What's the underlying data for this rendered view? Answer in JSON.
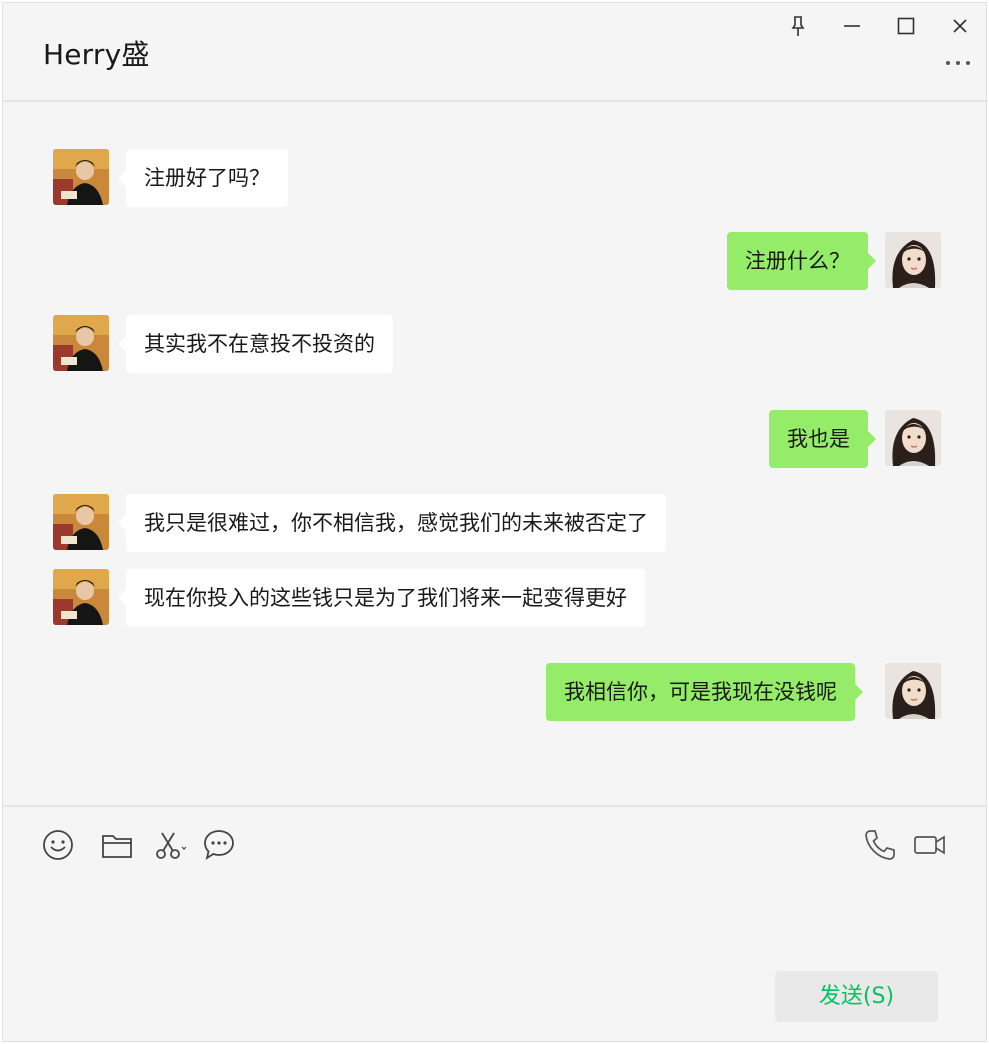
{
  "header": {
    "title": "Herry盛"
  },
  "messages": [
    {
      "side": "in",
      "text": "注册好了吗？"
    },
    {
      "side": "out",
      "text": "注册什么？"
    },
    {
      "side": "in",
      "text": "其实我不在意投不投资的"
    },
    {
      "side": "out",
      "text": "我也是"
    },
    {
      "side": "in",
      "text": "我只是很难过，你不相信我，感觉我们的未来被否定了"
    },
    {
      "side": "in",
      "text": "现在你投入的这些钱只是为了我们将来一起变得更好"
    },
    {
      "side": "out",
      "text": "我相信你，可是我现在没钱呢"
    }
  ],
  "composer": {
    "input_value": "",
    "send_label": "发送(S)"
  },
  "colors": {
    "window_bg": "#f5f5f5",
    "incoming_bubble": "#ffffff",
    "outgoing_bubble": "#95ec69",
    "send_text": "#07c160"
  },
  "icons": {
    "window_controls": [
      "pin-icon",
      "minimize-icon",
      "maximize-icon",
      "close-icon",
      "more-icon"
    ],
    "toolbar": [
      "emoji-icon",
      "folder-icon",
      "screenshot-scissors-icon",
      "chat-history-icon",
      "voice-call-icon",
      "video-call-icon"
    ]
  }
}
